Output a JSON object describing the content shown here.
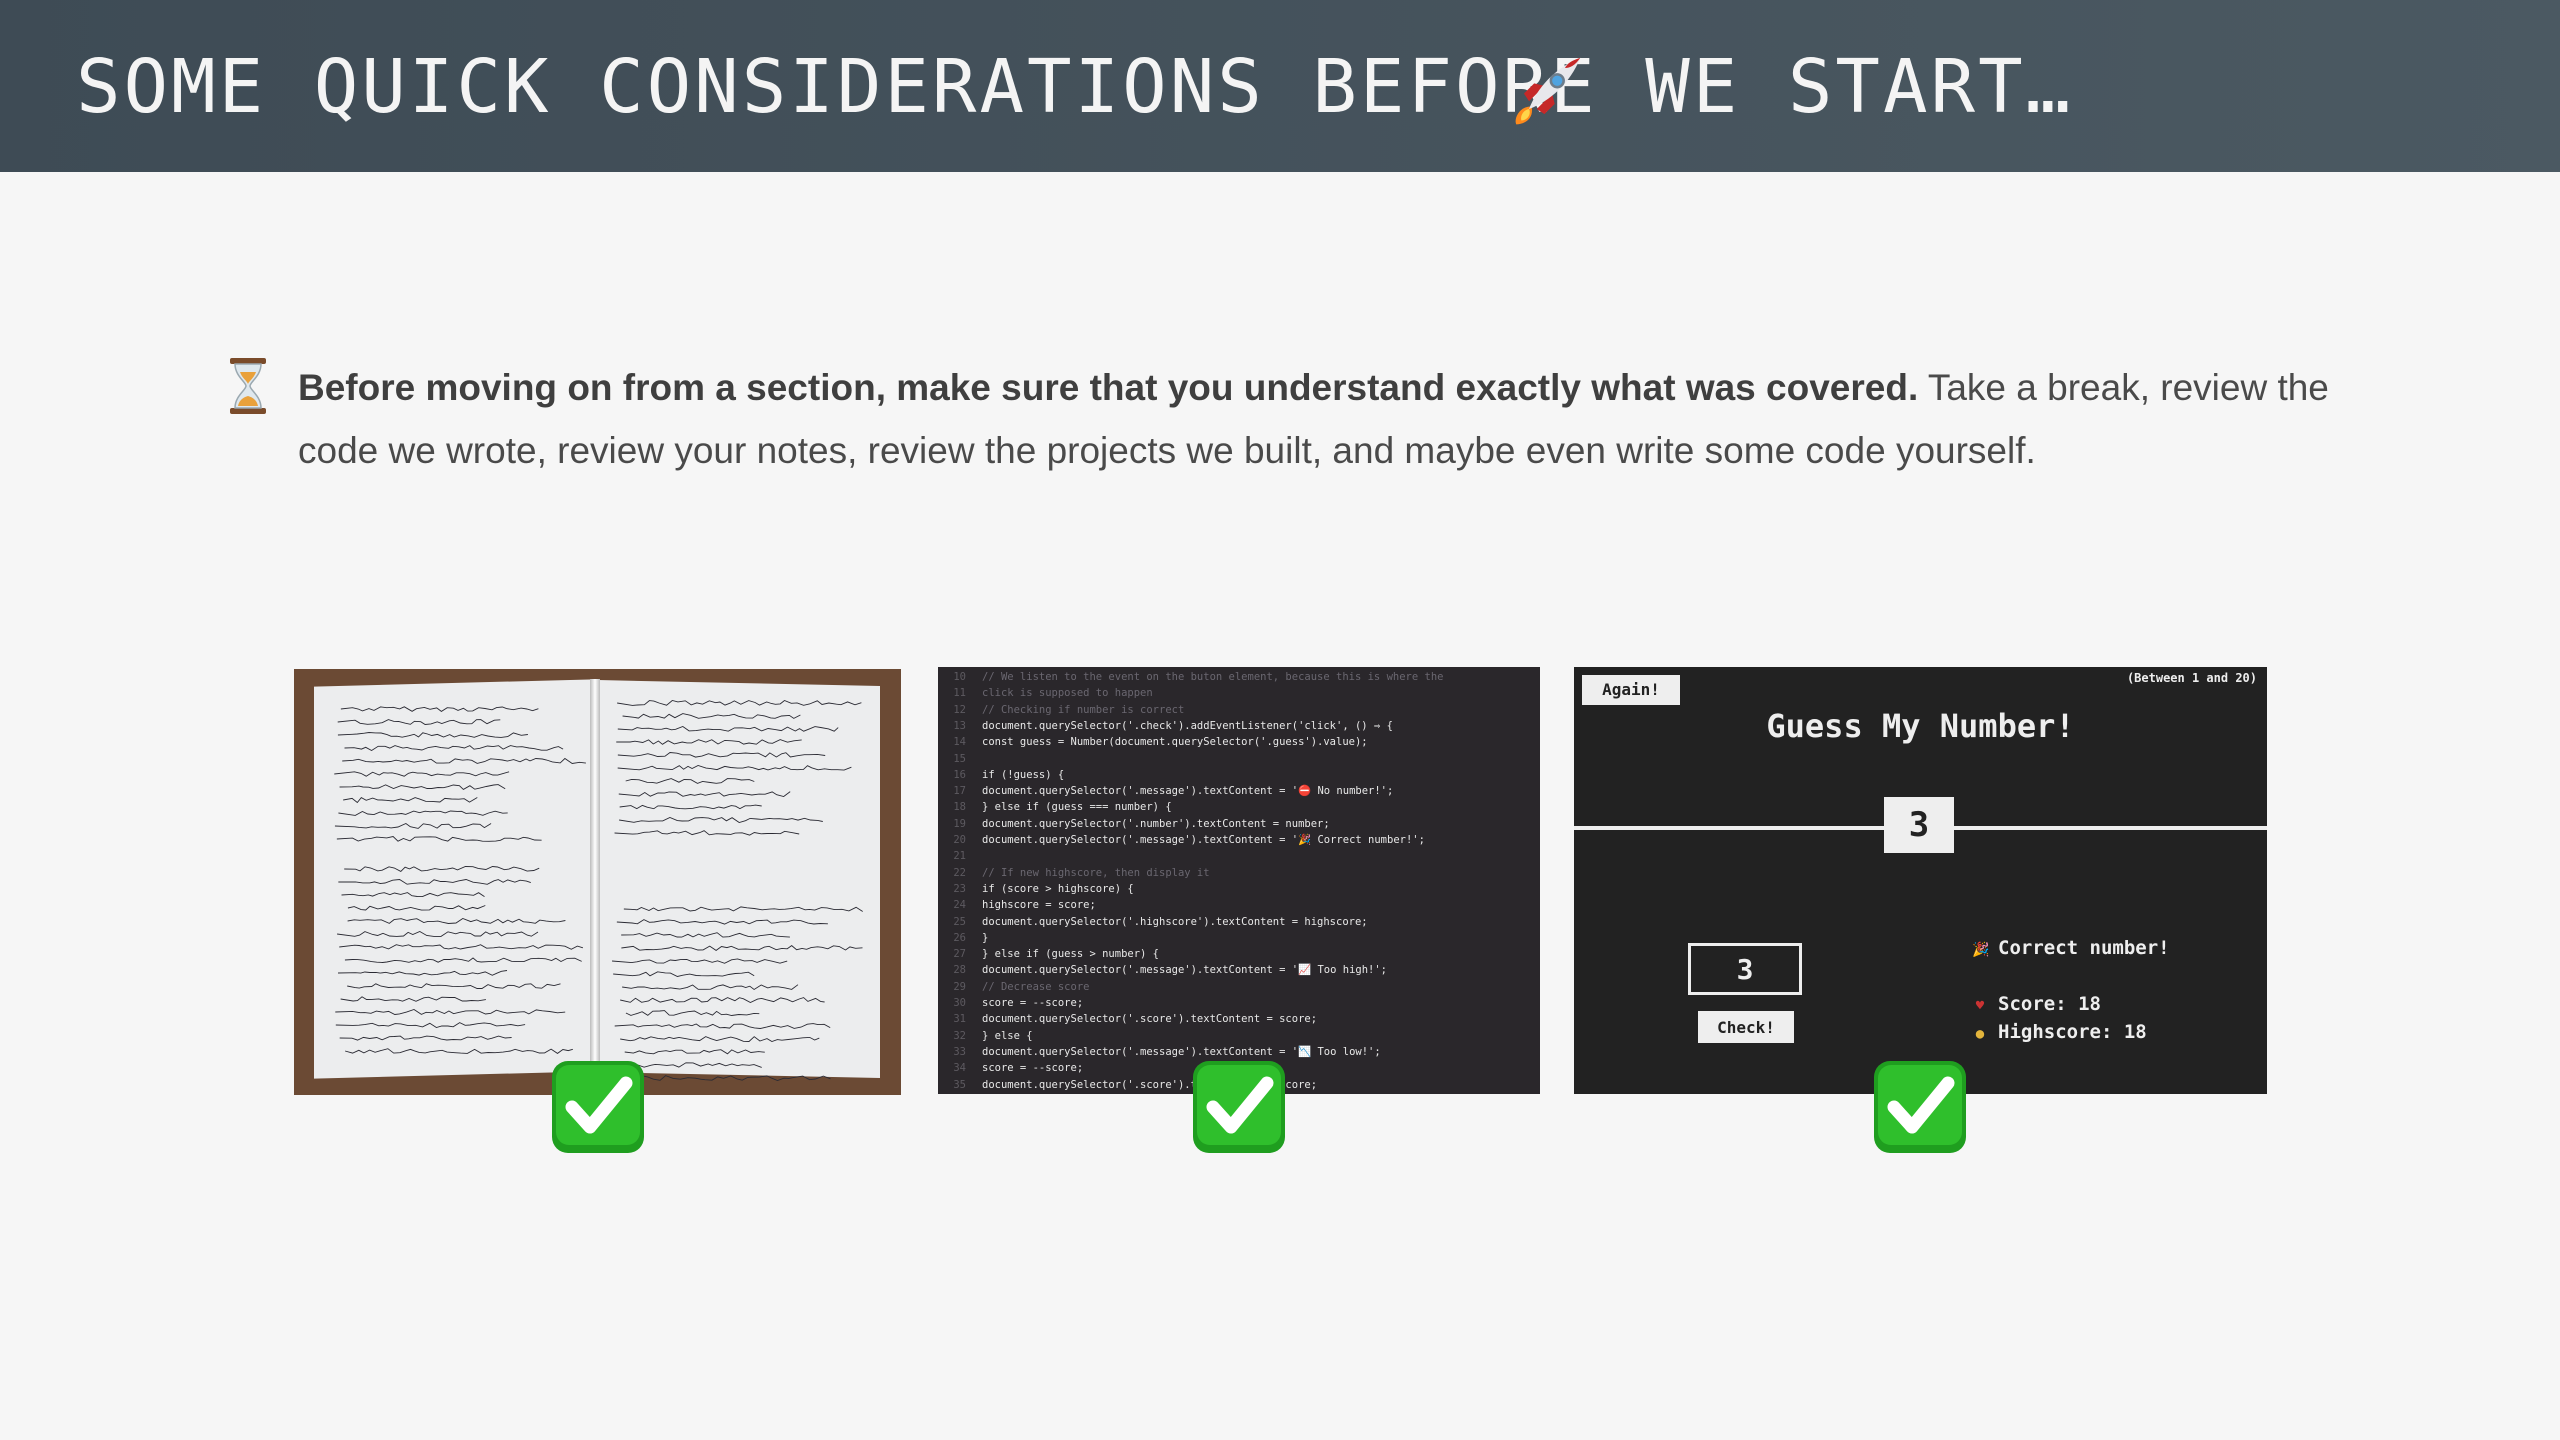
{
  "header": {
    "title": "Some quick considerations before we start…",
    "icon": "rocket-icon"
  },
  "note": {
    "icon": "hourglass-icon",
    "bold_text": "Before moving on from a section, make sure that you understand exactly what was covered.",
    "text": " Take a break, review the code we wrote, review your notes, review the projects we built, and maybe even write some code yourself."
  },
  "code_lines": [
    {
      "n": "10",
      "t": "// We listen to the event on the buton element, because this is where the",
      "c": "#6a6770"
    },
    {
      "n": "11",
      "t": "click is supposed to happen",
      "c": "#6a6770"
    },
    {
      "n": "12",
      "t": "// Checking if number is correct",
      "c": "#6a6770"
    },
    {
      "n": "13",
      "t": "document.querySelector('.check').addEventListener('click', () ⇒ {",
      "c": "#e8e8e8"
    },
    {
      "n": "14",
      "t": "  const guess = Number(document.querySelector('.guess').value);",
      "c": "#e8e8e8"
    },
    {
      "n": "15",
      "t": "",
      "c": "#e8e8e8"
    },
    {
      "n": "16",
      "t": "  if (!guess) {",
      "c": "#e8e8e8"
    },
    {
      "n": "17",
      "t": "    document.querySelector('.message').textContent = '⛔ No number!';",
      "c": "#e8e8e8"
    },
    {
      "n": "18",
      "t": "  } else if (guess === number) {",
      "c": "#e8e8e8"
    },
    {
      "n": "19",
      "t": "    document.querySelector('.number').textContent = number;",
      "c": "#e8e8e8"
    },
    {
      "n": "20",
      "t": "    document.querySelector('.message').textContent = '🎉 Correct number!';",
      "c": "#e8e8e8"
    },
    {
      "n": "21",
      "t": "",
      "c": "#e8e8e8"
    },
    {
      "n": "22",
      "t": "    // If new highscore, then display it",
      "c": "#6a6770"
    },
    {
      "n": "23",
      "t": "    if (score > highscore) {",
      "c": "#e8e8e8"
    },
    {
      "n": "24",
      "t": "      highscore = score;",
      "c": "#e8e8e8"
    },
    {
      "n": "25",
      "t": "      document.querySelector('.highscore').textContent = highscore;",
      "c": "#e8e8e8"
    },
    {
      "n": "26",
      "t": "    }",
      "c": "#e8e8e8"
    },
    {
      "n": "27",
      "t": "  } else if (guess > number) {",
      "c": "#e8e8e8"
    },
    {
      "n": "28",
      "t": "    document.querySelector('.message').textContent = '📈 Too high!';",
      "c": "#e8e8e8"
    },
    {
      "n": "29",
      "t": "    // Decrease score",
      "c": "#6a6770"
    },
    {
      "n": "30",
      "t": "    score = --score;",
      "c": "#e8e8e8"
    },
    {
      "n": "31",
      "t": "    document.querySelector('.score').textContent = score;",
      "c": "#e8e8e8"
    },
    {
      "n": "32",
      "t": "  } else {",
      "c": "#e8e8e8"
    },
    {
      "n": "33",
      "t": "    document.querySelector('.message').textContent = '📉 Too low!';",
      "c": "#e8e8e8"
    },
    {
      "n": "34",
      "t": "    score = --score;",
      "c": "#e8e8e8"
    },
    {
      "n": "35",
      "t": "    document.querySelector('.score').textContent = score;",
      "c": "#e8e8e8"
    }
  ],
  "game": {
    "again_label": "Again!",
    "between_text": "(Between 1 and 20)",
    "title": "Guess My Number!",
    "secret_number": "3",
    "guess_value": "3",
    "check_label": "Check!",
    "message": "Correct number!",
    "score_label": "Score: 18",
    "highscore_label": "Highscore: 18",
    "bg_color": "#222222",
    "text_color": "#eeeeee"
  },
  "checkmark_icon": "check-mark-button-icon",
  "colors": {
    "header_bg": "#404d57",
    "page_bg": "#f6f6f6",
    "check_green": "#22b321"
  }
}
